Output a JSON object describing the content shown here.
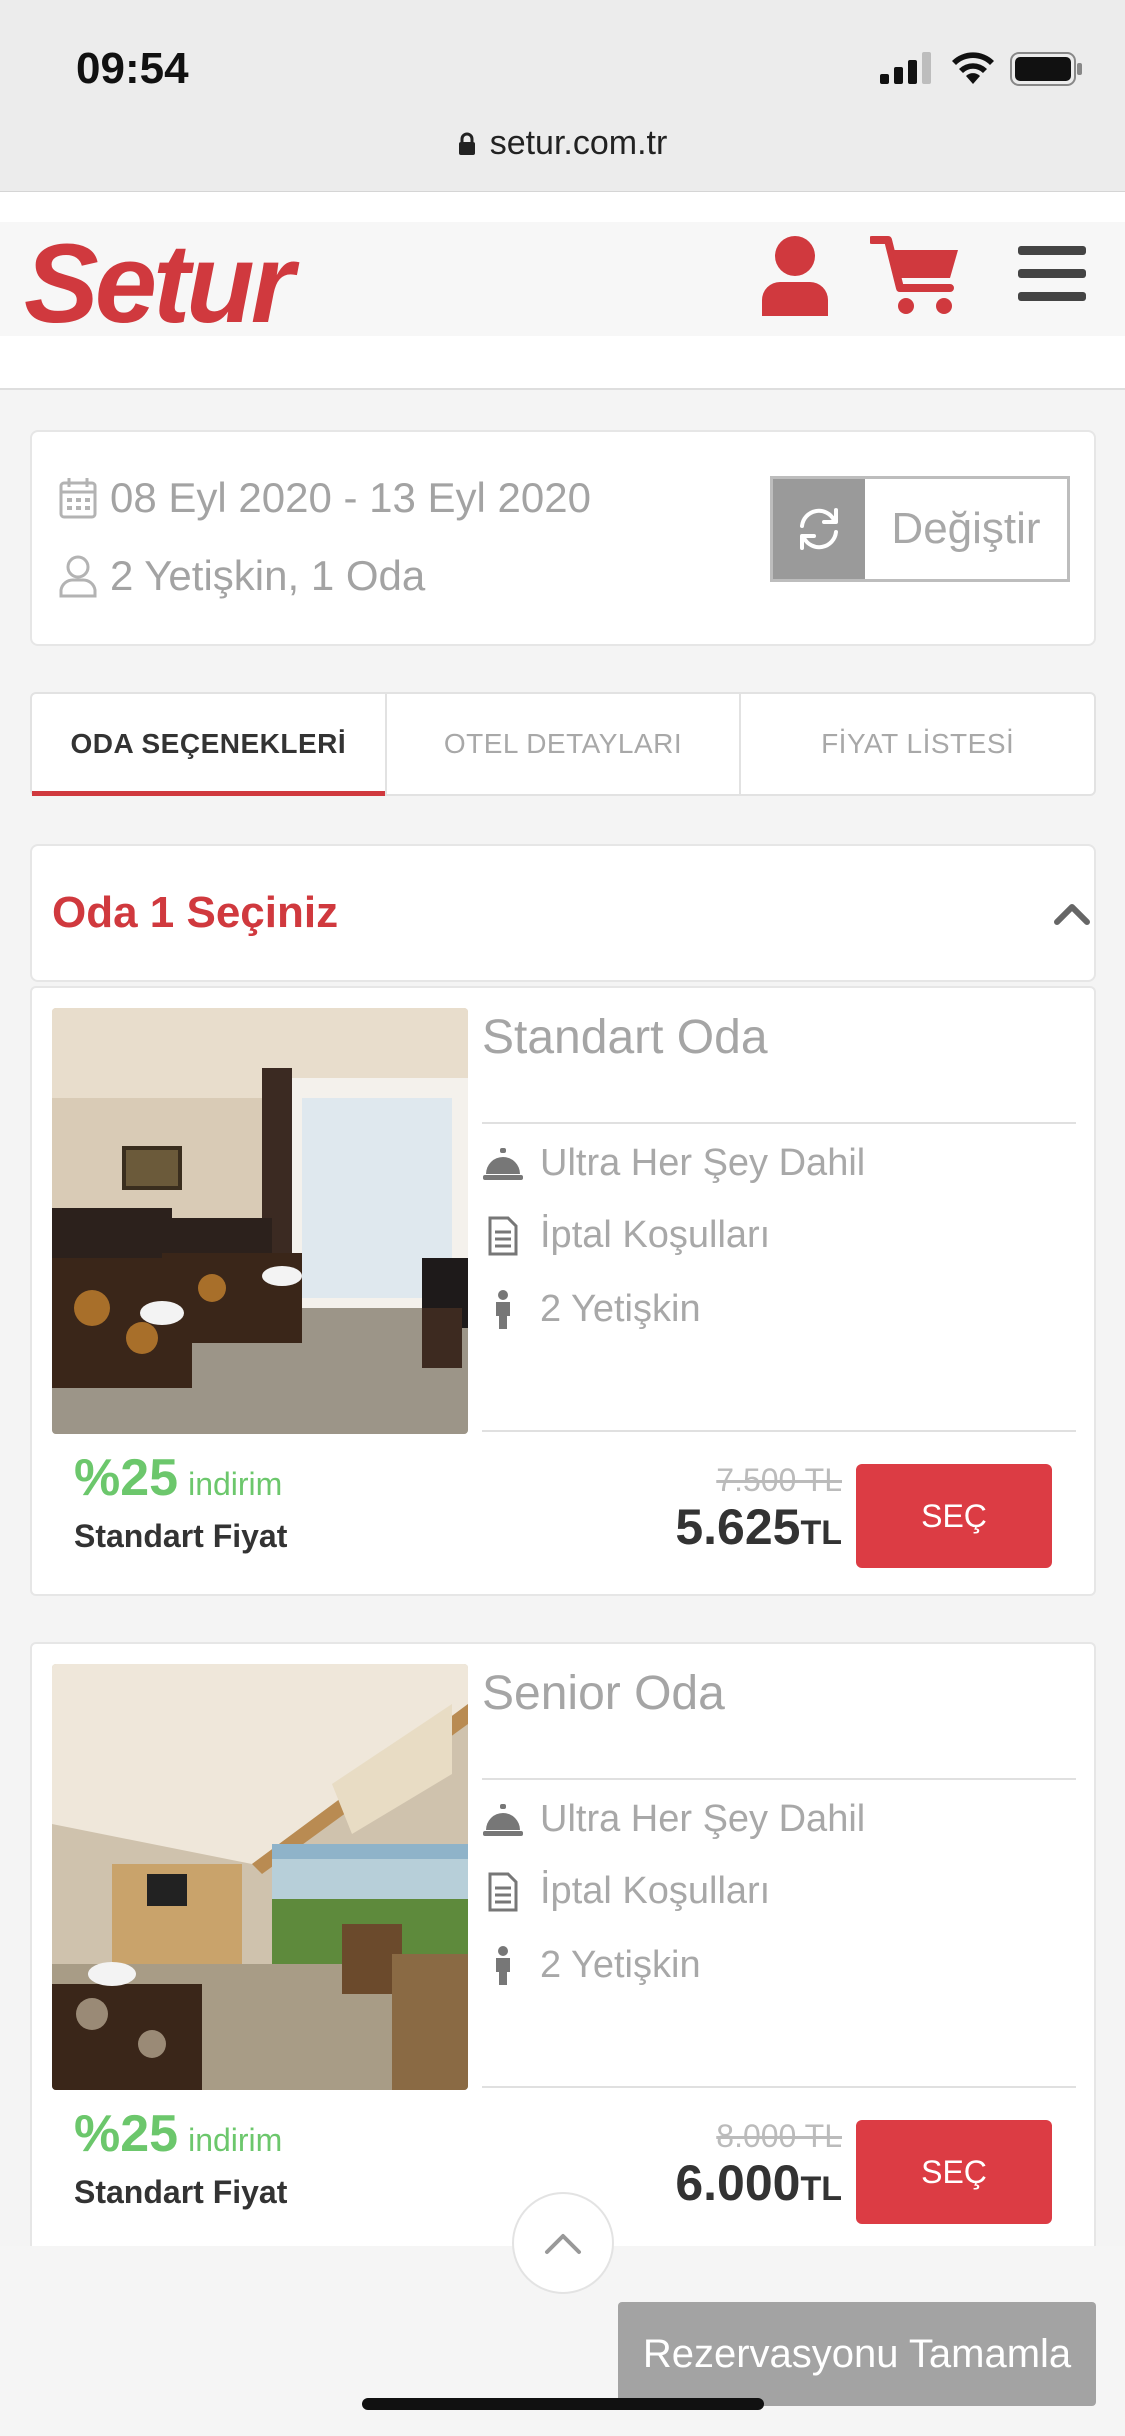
{
  "status_bar": {
    "time": "09:54"
  },
  "browser": {
    "url": "setur.com.tr"
  },
  "header": {
    "logo_text": "Setur",
    "brand_color": "#d0393e"
  },
  "search_summary": {
    "dates": "08 Eyl 2020 - 13 Eyl 2020",
    "guests": "2 Yetişkin, 1 Oda",
    "change_label": "Değiştir"
  },
  "tabs": [
    {
      "label": "ODA SEÇENEKLERİ",
      "active": true
    },
    {
      "label": "OTEL DETAYLARI",
      "active": false
    },
    {
      "label": "FİYAT LİSTESİ",
      "active": false
    }
  ],
  "room_section": {
    "title": "Oda 1 Seçiniz"
  },
  "rooms": [
    {
      "name": "Standart Oda",
      "features": [
        "Ultra Her Şey Dahil",
        "İptal Koşulları",
        "2 Yetişkin"
      ],
      "discount_pct": "%25",
      "discount_word": "indirim",
      "fare_type": "Standart Fiyat",
      "old_price": "7.500 TL",
      "new_price": "5.625",
      "currency": "TL",
      "button": "SEÇ"
    },
    {
      "name": "Senior Oda",
      "features": [
        "Ultra Her Şey Dahil",
        "İptal Koşulları",
        "2 Yetişkin"
      ],
      "discount_pct": "%25",
      "discount_word": "indirim",
      "fare_type": "Standart Fiyat",
      "old_price": "8.000 TL",
      "new_price": "6.000",
      "currency": "TL",
      "button": "SEÇ"
    }
  ],
  "footer": {
    "complete_label": "Rezervasyonu Tamamla"
  }
}
